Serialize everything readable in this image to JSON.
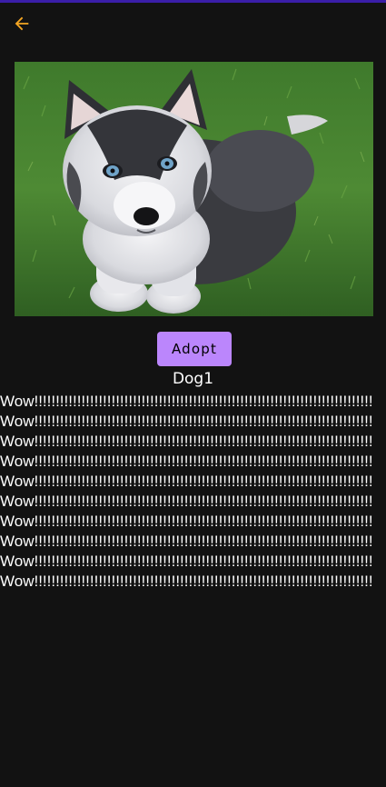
{
  "colors": {
    "background": "#121212",
    "accent": "#f5a623",
    "button": "#bb86fc",
    "button_text": "#000000",
    "top_bar": "#3a1ea8"
  },
  "toolbar": {
    "back_icon": "arrow-left-icon"
  },
  "dog": {
    "photo": "husky-puppy-photo",
    "name": "Dog1",
    "adopt_label": "Adopt"
  },
  "description": {
    "lines": [
      "Wow!!!!!!!!!!!!!!!!!!!!!!!!!!!!!!!!!!!!!!!!!!!!!!!!!!!!!!!!!!!!!!!!!!!!!!!!!!!!!!!",
      "Wow!!!!!!!!!!!!!!!!!!!!!!!!!!!!!!!!!!!!!!!!!!!!!!!!!!!!!!!!!!!!!!!!!!!!!!!!!!!!!!!",
      "Wow!!!!!!!!!!!!!!!!!!!!!!!!!!!!!!!!!!!!!!!!!!!!!!!!!!!!!!!!!!!!!!!!!!!!!!!!!!!!!!!",
      "Wow!!!!!!!!!!!!!!!!!!!!!!!!!!!!!!!!!!!!!!!!!!!!!!!!!!!!!!!!!!!!!!!!!!!!!!!!!!!!!!!",
      "Wow!!!!!!!!!!!!!!!!!!!!!!!!!!!!!!!!!!!!!!!!!!!!!!!!!!!!!!!!!!!!!!!!!!!!!!!!!!!!!!!",
      "Wow!!!!!!!!!!!!!!!!!!!!!!!!!!!!!!!!!!!!!!!!!!!!!!!!!!!!!!!!!!!!!!!!!!!!!!!!!!!!!!!",
      "Wow!!!!!!!!!!!!!!!!!!!!!!!!!!!!!!!!!!!!!!!!!!!!!!!!!!!!!!!!!!!!!!!!!!!!!!!!!!!!!!!",
      "Wow!!!!!!!!!!!!!!!!!!!!!!!!!!!!!!!!!!!!!!!!!!!!!!!!!!!!!!!!!!!!!!!!!!!!!!!!!!!!!!!",
      "Wow!!!!!!!!!!!!!!!!!!!!!!!!!!!!!!!!!!!!!!!!!!!!!!!!!!!!!!!!!!!!!!!!!!!!!!!!!!!!!!!",
      "Wow!!!!!!!!!!!!!!!!!!!!!!!!!!!!!!!!!!!!!!!!!!!!!!!!!!!!!!!!!!!!!!!!!!!!!!!!!!!!!!!"
    ]
  }
}
